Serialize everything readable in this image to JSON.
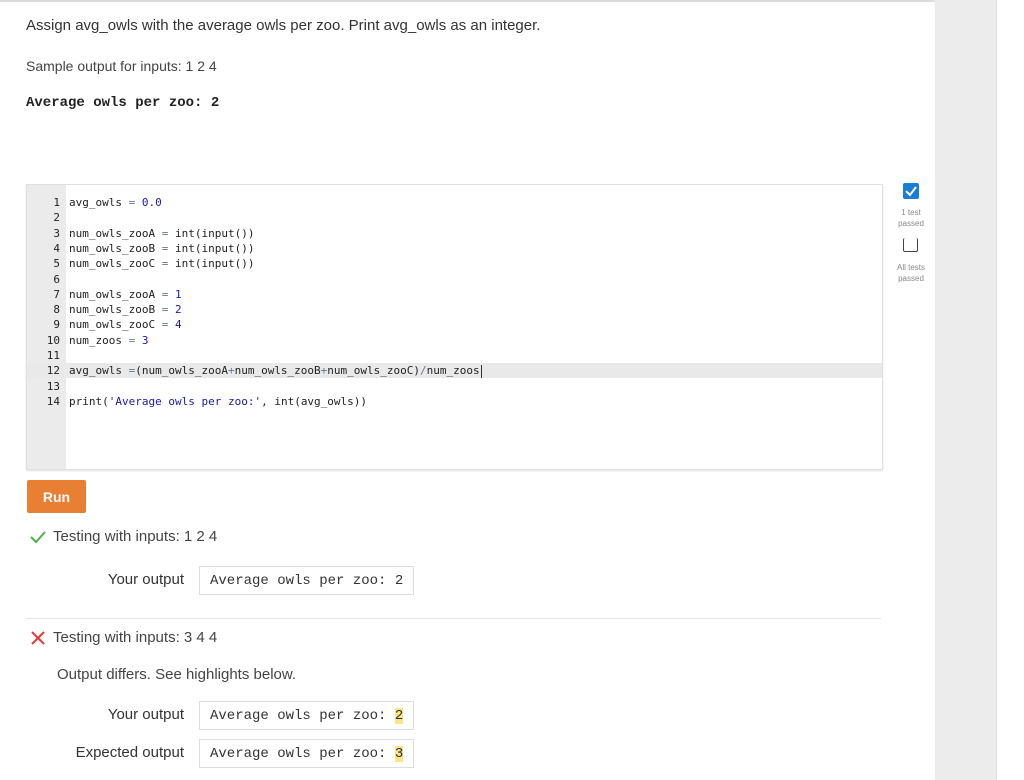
{
  "prompt": "Assign avg_owls with the average owls per zoo. Print avg_owls as an integer.",
  "sample_label": "Sample output for inputs: 1 2 4",
  "sample_output": "Average owls per zoo: 2",
  "editor": {
    "lines": [
      {
        "n": "1",
        "tokens": [
          [
            "avg_owls ",
            ""
          ],
          [
            "=",
            "op"
          ],
          [
            " ",
            ""
          ],
          [
            "0.0",
            "num"
          ]
        ]
      },
      {
        "n": "2",
        "tokens": []
      },
      {
        "n": "3",
        "tokens": [
          [
            "num_owls_zooA ",
            ""
          ],
          [
            "=",
            "op"
          ],
          [
            " int(input())",
            ""
          ]
        ]
      },
      {
        "n": "4",
        "tokens": [
          [
            "num_owls_zooB ",
            ""
          ],
          [
            "=",
            "op"
          ],
          [
            " int(input())",
            ""
          ]
        ]
      },
      {
        "n": "5",
        "tokens": [
          [
            "num_owls_zooC ",
            ""
          ],
          [
            "=",
            "op"
          ],
          [
            " int(input())",
            ""
          ]
        ]
      },
      {
        "n": "6",
        "tokens": []
      },
      {
        "n": "7",
        "tokens": [
          [
            "num_owls_zooA ",
            ""
          ],
          [
            "=",
            "op"
          ],
          [
            " ",
            ""
          ],
          [
            "1",
            "num"
          ]
        ]
      },
      {
        "n": "8",
        "tokens": [
          [
            "num_owls_zooB ",
            ""
          ],
          [
            "=",
            "op"
          ],
          [
            " ",
            ""
          ],
          [
            "2",
            "num"
          ]
        ]
      },
      {
        "n": "9",
        "tokens": [
          [
            "num_owls_zooC ",
            ""
          ],
          [
            "=",
            "op"
          ],
          [
            " ",
            ""
          ],
          [
            "4",
            "num"
          ]
        ]
      },
      {
        "n": "10",
        "tokens": [
          [
            "num_zoos ",
            ""
          ],
          [
            "=",
            "op"
          ],
          [
            " ",
            ""
          ],
          [
            "3",
            "num"
          ]
        ]
      },
      {
        "n": "11",
        "tokens": []
      },
      {
        "n": "12",
        "tokens": [
          [
            "avg_owls ",
            ""
          ],
          [
            "=",
            "op"
          ],
          [
            "(num_owls_zooA",
            ""
          ],
          [
            "+",
            "op"
          ],
          [
            "num_owls_zooB",
            ""
          ],
          [
            "+",
            "op"
          ],
          [
            "num_owls_zooC)",
            ""
          ],
          [
            "/",
            "op"
          ],
          [
            "num_zoos",
            ""
          ]
        ],
        "active": true
      },
      {
        "n": "13",
        "tokens": []
      },
      {
        "n": "14",
        "tokens": [
          [
            "print(",
            ""
          ],
          [
            "'Average owls per zoo:'",
            "str"
          ],
          [
            ", int(avg_owls))",
            ""
          ]
        ]
      }
    ]
  },
  "run_label": "Run",
  "tests": [
    {
      "heading": "Testing with inputs: 1 2 4",
      "passed": true,
      "your_output_label": "Your output",
      "your_output": "Average owls per zoo: 2"
    },
    {
      "heading": "Testing with inputs: 3 4 4",
      "passed": false,
      "note": "Output differs. See highlights below.",
      "your_output_label": "Your output",
      "your_output_prefix": "Average owls per zoo: ",
      "your_output_diff": "2",
      "expected_output_label": "Expected output",
      "expected_output_prefix": "Average owls per zoo: ",
      "expected_output_diff": "3"
    }
  ],
  "status": {
    "one_test": "1 test passed",
    "all_tests": "All tests passed"
  },
  "colors": {
    "run": "#e97f33",
    "check_blue": "#1a7fd4",
    "pass_green": "#4caf50",
    "fail_red": "#e53935",
    "highlight": "#f6e58a"
  },
  "icons": [
    "check-icon",
    "cross-icon",
    "checkbox-checked-icon",
    "checkbox-empty-icon"
  ]
}
